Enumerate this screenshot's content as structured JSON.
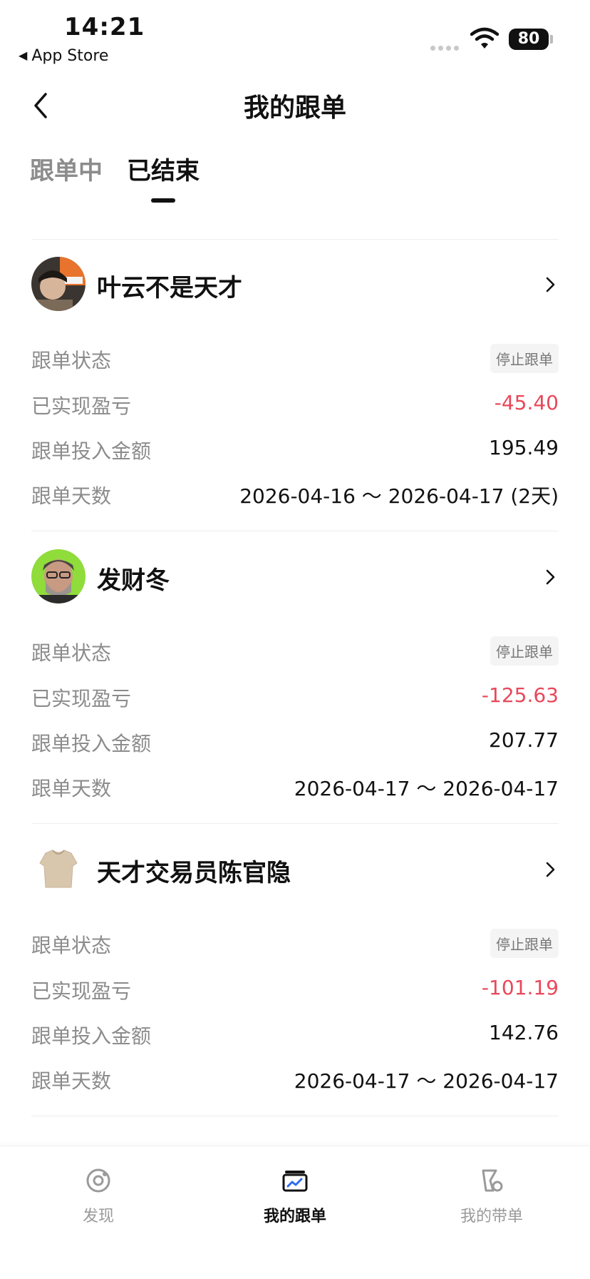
{
  "status_bar": {
    "time": "14:21",
    "back_app": "App Store",
    "battery": "80"
  },
  "nav": {
    "title": "我的跟单"
  },
  "tabs": [
    {
      "label": "跟单中",
      "active": false
    },
    {
      "label": "已结束",
      "active": true
    }
  ],
  "labels": {
    "status": "跟单状态",
    "pnl": "已实现盈亏",
    "amount": "跟单投入金额",
    "days": "跟单天数"
  },
  "traders": [
    {
      "name": "叶云不是天才",
      "status": "停止跟单",
      "pnl": "-45.40",
      "amount": "195.49",
      "days": "2026-04-16 ～ 2026-04-17 (2天)"
    },
    {
      "name": "发财冬",
      "status": "停止跟单",
      "pnl": "-125.63",
      "amount": "207.77",
      "days": "2026-04-17 ～ 2026-04-17"
    },
    {
      "name": "天才交易员陈官隐",
      "status": "停止跟单",
      "pnl": "-101.19",
      "amount": "142.76",
      "days": "2026-04-17 ～ 2026-04-17"
    }
  ],
  "tabbar": [
    {
      "label": "发现",
      "icon": "discover-icon",
      "active": false
    },
    {
      "label": "我的跟单",
      "icon": "copy-trade-icon",
      "active": true
    },
    {
      "label": "我的带单",
      "icon": "lead-trade-icon",
      "active": false
    }
  ],
  "colors": {
    "loss": "#e8485a",
    "muted": "#8c8c8c",
    "text": "#111111"
  }
}
